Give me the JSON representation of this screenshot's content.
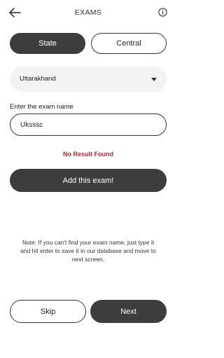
{
  "header": {
    "title": "EXAMS",
    "back_icon": "arrow-left-icon",
    "info_icon": "info-icon"
  },
  "segments": {
    "state_label": "State",
    "central_label": "Central",
    "selected": "State"
  },
  "dropdown": {
    "selected_value": "Uttarakhand",
    "icon": "caret-down-icon"
  },
  "exam_field": {
    "label": "Enter the exam name",
    "value": "Uksssc"
  },
  "status": {
    "message": "No Result Found"
  },
  "add_button": {
    "label": "Add this exam!"
  },
  "note": {
    "text": "Note: If you can't find your exam name, just type it and hit enter to save it in our database and move to next screen."
  },
  "footer": {
    "skip_label": "Skip",
    "next_label": "Next"
  },
  "colors": {
    "primary_dark": "#3d3d3d",
    "error_red": "#c0272d",
    "dropdown_bg": "#f3f3f3"
  }
}
